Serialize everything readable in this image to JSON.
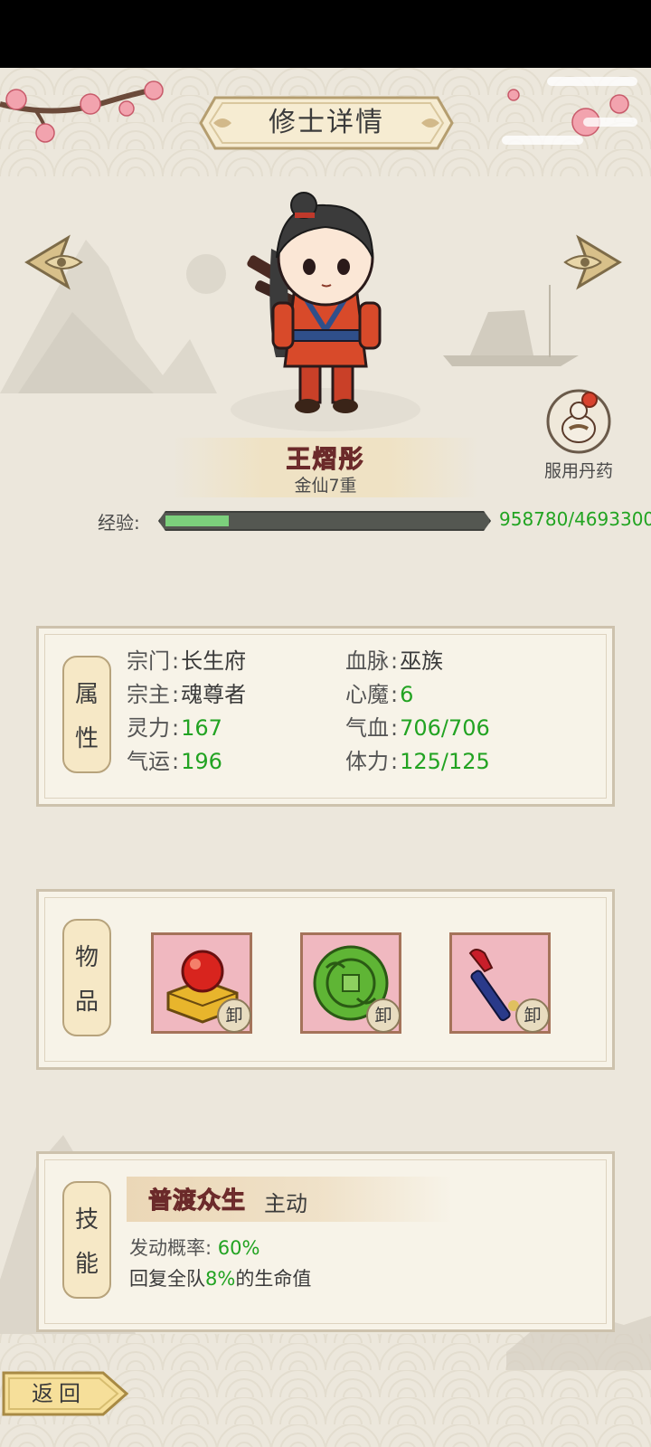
{
  "header": {
    "title": "修士详情"
  },
  "character": {
    "name": "王熠彤",
    "rank": "金仙7重",
    "exp_label": "经验:",
    "exp_value": "958780/4693300",
    "exp_progress": 0.2
  },
  "pill_button": {
    "label": "服用丹药"
  },
  "attributes": {
    "tag": [
      "属",
      "性"
    ],
    "rows": [
      {
        "key": "宗门",
        "value": "长生府",
        "style": "dark"
      },
      {
        "key": "血脉",
        "value": "巫族",
        "style": "dark"
      },
      {
        "key": "宗主",
        "value": "魂尊者",
        "style": "dark"
      },
      {
        "key": "心魔",
        "value": "6",
        "style": "green"
      },
      {
        "key": "灵力",
        "value": "167",
        "style": "green"
      },
      {
        "key": "气血",
        "value": "706/706",
        "style": "green"
      },
      {
        "key": "气运",
        "value": "196",
        "style": "green"
      },
      {
        "key": "体力",
        "value": "125/125",
        "style": "green"
      }
    ],
    "colon": ":"
  },
  "items": {
    "tag": [
      "物",
      "品"
    ],
    "slots": [
      {
        "icon": "golden-seal-icon",
        "action": "卸"
      },
      {
        "icon": "jade-pendant-icon",
        "action": "卸"
      },
      {
        "icon": "brush-weapon-icon",
        "action": "卸"
      }
    ]
  },
  "skill": {
    "tag": [
      "技",
      "能"
    ],
    "name": "普渡众生",
    "type": "主动",
    "chance_label": "发动概率:",
    "chance_value": "60%",
    "desc_prefix": "回复全队",
    "desc_value": "8%",
    "desc_suffix": "的生命值"
  },
  "footer": {
    "back_label": "返回"
  },
  "colors": {
    "accent_green": "#22a322",
    "name_red": "#d65a5a",
    "panel_bg": "#f7f3e8",
    "exp_fill": "#7cd07c"
  }
}
